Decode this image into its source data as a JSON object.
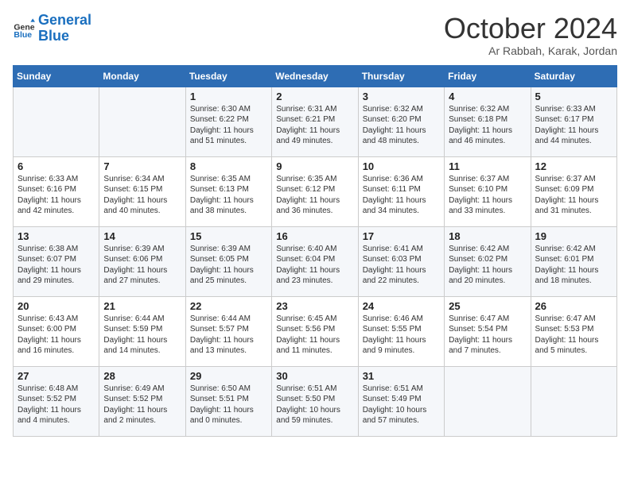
{
  "header": {
    "logo_line1": "General",
    "logo_line2": "Blue",
    "month": "October 2024",
    "location": "Ar Rabbah, Karak, Jordan"
  },
  "weekdays": [
    "Sunday",
    "Monday",
    "Tuesday",
    "Wednesday",
    "Thursday",
    "Friday",
    "Saturday"
  ],
  "weeks": [
    [
      {
        "day": "",
        "info": ""
      },
      {
        "day": "",
        "info": ""
      },
      {
        "day": "1",
        "info": "Sunrise: 6:30 AM\nSunset: 6:22 PM\nDaylight: 11 hours and 51 minutes."
      },
      {
        "day": "2",
        "info": "Sunrise: 6:31 AM\nSunset: 6:21 PM\nDaylight: 11 hours and 49 minutes."
      },
      {
        "day": "3",
        "info": "Sunrise: 6:32 AM\nSunset: 6:20 PM\nDaylight: 11 hours and 48 minutes."
      },
      {
        "day": "4",
        "info": "Sunrise: 6:32 AM\nSunset: 6:18 PM\nDaylight: 11 hours and 46 minutes."
      },
      {
        "day": "5",
        "info": "Sunrise: 6:33 AM\nSunset: 6:17 PM\nDaylight: 11 hours and 44 minutes."
      }
    ],
    [
      {
        "day": "6",
        "info": "Sunrise: 6:33 AM\nSunset: 6:16 PM\nDaylight: 11 hours and 42 minutes."
      },
      {
        "day": "7",
        "info": "Sunrise: 6:34 AM\nSunset: 6:15 PM\nDaylight: 11 hours and 40 minutes."
      },
      {
        "day": "8",
        "info": "Sunrise: 6:35 AM\nSunset: 6:13 PM\nDaylight: 11 hours and 38 minutes."
      },
      {
        "day": "9",
        "info": "Sunrise: 6:35 AM\nSunset: 6:12 PM\nDaylight: 11 hours and 36 minutes."
      },
      {
        "day": "10",
        "info": "Sunrise: 6:36 AM\nSunset: 6:11 PM\nDaylight: 11 hours and 34 minutes."
      },
      {
        "day": "11",
        "info": "Sunrise: 6:37 AM\nSunset: 6:10 PM\nDaylight: 11 hours and 33 minutes."
      },
      {
        "day": "12",
        "info": "Sunrise: 6:37 AM\nSunset: 6:09 PM\nDaylight: 11 hours and 31 minutes."
      }
    ],
    [
      {
        "day": "13",
        "info": "Sunrise: 6:38 AM\nSunset: 6:07 PM\nDaylight: 11 hours and 29 minutes."
      },
      {
        "day": "14",
        "info": "Sunrise: 6:39 AM\nSunset: 6:06 PM\nDaylight: 11 hours and 27 minutes."
      },
      {
        "day": "15",
        "info": "Sunrise: 6:39 AM\nSunset: 6:05 PM\nDaylight: 11 hours and 25 minutes."
      },
      {
        "day": "16",
        "info": "Sunrise: 6:40 AM\nSunset: 6:04 PM\nDaylight: 11 hours and 23 minutes."
      },
      {
        "day": "17",
        "info": "Sunrise: 6:41 AM\nSunset: 6:03 PM\nDaylight: 11 hours and 22 minutes."
      },
      {
        "day": "18",
        "info": "Sunrise: 6:42 AM\nSunset: 6:02 PM\nDaylight: 11 hours and 20 minutes."
      },
      {
        "day": "19",
        "info": "Sunrise: 6:42 AM\nSunset: 6:01 PM\nDaylight: 11 hours and 18 minutes."
      }
    ],
    [
      {
        "day": "20",
        "info": "Sunrise: 6:43 AM\nSunset: 6:00 PM\nDaylight: 11 hours and 16 minutes."
      },
      {
        "day": "21",
        "info": "Sunrise: 6:44 AM\nSunset: 5:59 PM\nDaylight: 11 hours and 14 minutes."
      },
      {
        "day": "22",
        "info": "Sunrise: 6:44 AM\nSunset: 5:57 PM\nDaylight: 11 hours and 13 minutes."
      },
      {
        "day": "23",
        "info": "Sunrise: 6:45 AM\nSunset: 5:56 PM\nDaylight: 11 hours and 11 minutes."
      },
      {
        "day": "24",
        "info": "Sunrise: 6:46 AM\nSunset: 5:55 PM\nDaylight: 11 hours and 9 minutes."
      },
      {
        "day": "25",
        "info": "Sunrise: 6:47 AM\nSunset: 5:54 PM\nDaylight: 11 hours and 7 minutes."
      },
      {
        "day": "26",
        "info": "Sunrise: 6:47 AM\nSunset: 5:53 PM\nDaylight: 11 hours and 5 minutes."
      }
    ],
    [
      {
        "day": "27",
        "info": "Sunrise: 6:48 AM\nSunset: 5:52 PM\nDaylight: 11 hours and 4 minutes."
      },
      {
        "day": "28",
        "info": "Sunrise: 6:49 AM\nSunset: 5:52 PM\nDaylight: 11 hours and 2 minutes."
      },
      {
        "day": "29",
        "info": "Sunrise: 6:50 AM\nSunset: 5:51 PM\nDaylight: 11 hours and 0 minutes."
      },
      {
        "day": "30",
        "info": "Sunrise: 6:51 AM\nSunset: 5:50 PM\nDaylight: 10 hours and 59 minutes."
      },
      {
        "day": "31",
        "info": "Sunrise: 6:51 AM\nSunset: 5:49 PM\nDaylight: 10 hours and 57 minutes."
      },
      {
        "day": "",
        "info": ""
      },
      {
        "day": "",
        "info": ""
      }
    ]
  ]
}
